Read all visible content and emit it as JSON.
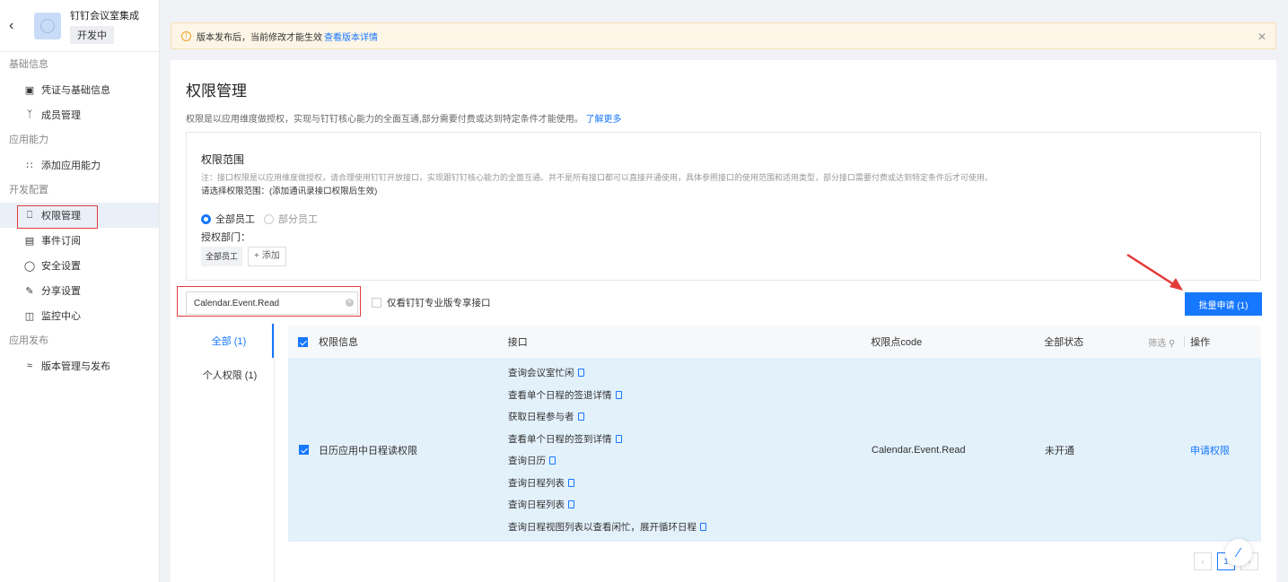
{
  "app": {
    "name": "钉钉会议室集成",
    "status": "开发中"
  },
  "sidebar": {
    "sections": [
      {
        "title": "基础信息",
        "items": [
          {
            "label": "凭证与基础信息",
            "icon": "credential-icon"
          },
          {
            "label": "成员管理",
            "icon": "user-icon"
          }
        ]
      },
      {
        "title": "应用能力",
        "items": [
          {
            "label": "添加应用能力",
            "icon": "apps-icon"
          }
        ]
      },
      {
        "title": "开发配置",
        "items": [
          {
            "label": "权限管理",
            "icon": "lock-icon",
            "active": true
          },
          {
            "label": "事件订阅",
            "icon": "event-icon"
          },
          {
            "label": "安全设置",
            "icon": "shield-icon"
          },
          {
            "label": "分享设置",
            "icon": "share-icon"
          },
          {
            "label": "监控中心",
            "icon": "monitor-icon"
          }
        ]
      },
      {
        "title": "应用发布",
        "items": [
          {
            "label": "版本管理与发布",
            "icon": "layers-icon"
          }
        ]
      }
    ]
  },
  "notice": {
    "text": "版本发布后，当前修改才能生效",
    "link": "查看版本详情"
  },
  "page": {
    "title": "权限管理",
    "desc": "权限是以应用维度做授权，实现与钉钉核心能力的全面互通,部分需要付费或达到特定条件才能使用。",
    "desc_link": "了解更多"
  },
  "scope": {
    "title": "权限范围",
    "note": "注：接口权限是以应用维度做授权，请合理使用钉钉开放接口，实现跟钉钉核心能力的全面互通。并不是所有接口都可以直接开通使用，具体参照接口的使用范围和适用类型，部分接口需要付费或达到特定条件后才可使用。",
    "choose": "请选择权限范围：(添加通讯录接口权限后生效)",
    "radio_all": "全部员工",
    "radio_part": "部分员工",
    "dept_label": "授权部门：",
    "dept_tag": "全部员工",
    "add_label": "添加"
  },
  "filters": {
    "search_value": "Calendar.Event.Read",
    "only_pro": "仅看钉钉专业版专享接口",
    "batch_btn": "批量申请 (1)"
  },
  "tabs": [
    {
      "label": "全部 (1)",
      "active": true
    },
    {
      "label": "个人权限 (1)"
    }
  ],
  "table": {
    "headers": {
      "info": "权限信息",
      "api": "接口",
      "code": "权限点code",
      "status": "全部状态",
      "filter": "筛选",
      "op": "操作"
    },
    "row": {
      "info": "日历应用中日程读权限",
      "apis": [
        "查询会议室忙闲",
        "查看单个日程的签退详情",
        "获取日程参与者",
        "查看单个日程的签到详情",
        "查询日历",
        "查询日程列表",
        "查询日程列表",
        "查询日程视图列表以查看闲忙，展开循环日程"
      ],
      "code": "Calendar.Event.Read",
      "status": "未开通",
      "op": "申请权限"
    }
  },
  "pager": {
    "current": "1"
  },
  "colors": {
    "accent": "#1677ff",
    "highlight": "#e23b3b",
    "selected_row": "#e3f1fb"
  }
}
